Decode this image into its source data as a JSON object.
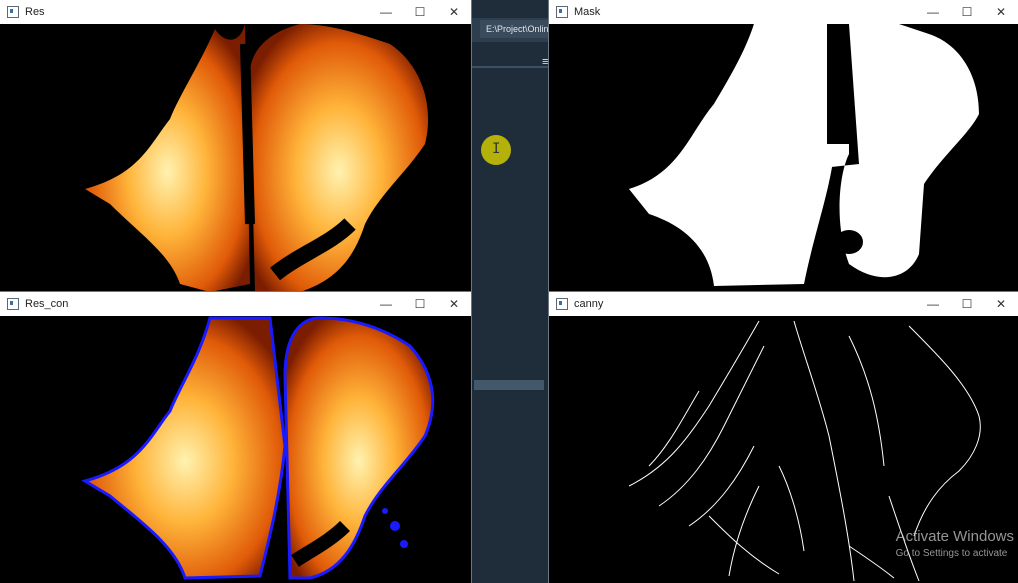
{
  "ide": {
    "path_text": "E:\\Project\\Online (",
    "menu_glyph": "≡"
  },
  "windows": {
    "res": {
      "title": "Res"
    },
    "mask": {
      "title": "Mask"
    },
    "res_con": {
      "title": "Res_con"
    },
    "canny": {
      "title": "canny"
    }
  },
  "controls": {
    "minimize": "—",
    "maximize": "☐",
    "close": "✕"
  },
  "watermark": {
    "line1": "Activate Windows",
    "line2": "Go to Settings to activate"
  },
  "colors": {
    "contour": "#1a1aff",
    "flame_outer": "#e8620a",
    "flame_core": "#ffcf5a",
    "mask": "#ffffff",
    "titlebar": "#ffffff"
  }
}
